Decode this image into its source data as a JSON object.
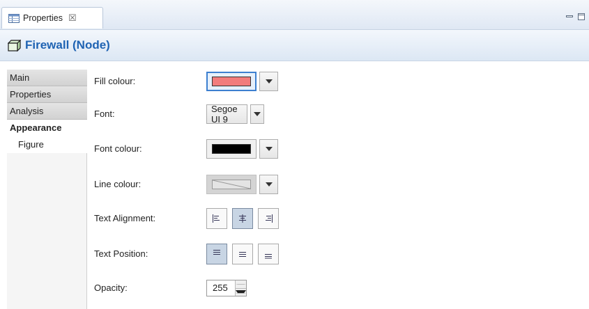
{
  "view": {
    "tab_label": "Properties",
    "close_glyph": "☒"
  },
  "header": {
    "title": "Firewall (Node)"
  },
  "sections": [
    {
      "label": "Main"
    },
    {
      "label": "Properties"
    },
    {
      "label": "Analysis"
    },
    {
      "label": "Appearance"
    },
    {
      "label": "Figure"
    }
  ],
  "selected_section": "Appearance",
  "form": {
    "fill_colour": {
      "label": "Fill colour:",
      "value": "#f27c7c"
    },
    "font": {
      "label": "Font:",
      "value": "Segoe UI 9"
    },
    "font_colour": {
      "label": "Font colour:",
      "value": "#000000"
    },
    "line_colour": {
      "label": "Line colour:",
      "enabled": false
    },
    "text_alignment": {
      "label": "Text Alignment:",
      "options": [
        "left",
        "center",
        "right"
      ],
      "selected": "center"
    },
    "text_position": {
      "label": "Text Position:",
      "options": [
        "top",
        "middle",
        "bottom"
      ],
      "selected": "top"
    },
    "opacity": {
      "label": "Opacity:",
      "value": "255"
    }
  },
  "icons": {
    "tab": "properties-table-icon",
    "title": "node-icon",
    "minimize": "minimize-icon",
    "maximize": "maximize-icon"
  },
  "colors": {
    "accent": "#1f63b3",
    "focus": "#3c7fd0",
    "toggle_selected": "#c8d5e4"
  }
}
